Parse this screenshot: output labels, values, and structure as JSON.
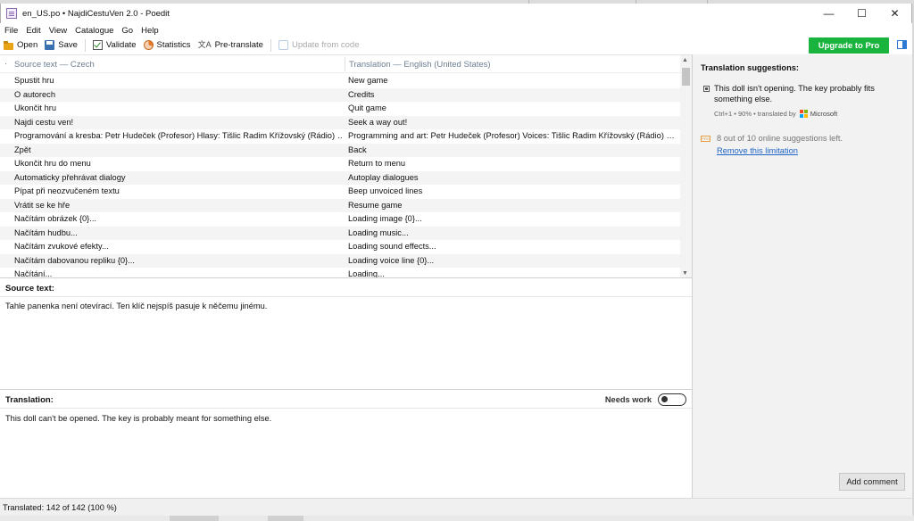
{
  "window": {
    "title": "en_US.po • NajdiCestuVen 2.0 - Poedit",
    "minimize": "—",
    "maximize": "☐",
    "close": "✕"
  },
  "menu": [
    "File",
    "Edit",
    "View",
    "Catalogue",
    "Go",
    "Help"
  ],
  "toolbar": {
    "open": "Open",
    "save": "Save",
    "validate": "Validate",
    "statistics": "Statistics",
    "pretranslate": "Pre-translate",
    "update_from_code": "Update from code",
    "upgrade": "Upgrade to Pro"
  },
  "list": {
    "source_header": "Source text — Czech",
    "translation_header": "Translation — English (United States)",
    "rows": [
      {
        "source": "Spustit hru",
        "translation": "New game"
      },
      {
        "source": "O autorech",
        "translation": "Credits"
      },
      {
        "source": "Ukončit hru",
        "translation": "Quit game"
      },
      {
        "source": "Najdi cestu ven!",
        "translation": "Seek a way out!"
      },
      {
        "source": "Programování a kresba:  Petr Hudeček (Profesor)  Hlasy:  Tišlic Radim Křížovský (Rádio)  …",
        "translation": "Programming and art:  Petr Hudeček (Profesor)  Voices:  Tišlic Radim Křížovský (Rádio)  …"
      },
      {
        "source": "Zpět",
        "translation": "Back"
      },
      {
        "source": "Ukončit hru do menu",
        "translation": "Return to menu"
      },
      {
        "source": "Automaticky přehrávat dialogy",
        "translation": "Autoplay dialogues"
      },
      {
        "source": "Pípat při neozvučeném textu",
        "translation": "Beep unvoiced lines"
      },
      {
        "source": "Vrátit se ke hře",
        "translation": "Resume game"
      },
      {
        "source": "Načítám obrázek {0}...",
        "translation": "Loading image {0}..."
      },
      {
        "source": "Načítám hudbu...",
        "translation": "Loading music..."
      },
      {
        "source": "Načítám zvukové efekty...",
        "translation": "Loading sound effects..."
      },
      {
        "source": "Načítám dabovanou repliku {0}...",
        "translation": "Loading voice line {0}..."
      },
      {
        "source": "Načítání...",
        "translation": "Loading..."
      }
    ]
  },
  "source_panel": {
    "label": "Source text:",
    "text": "Tahle panenka není otevírací. Ten klíč nejspíš pasuje k něčemu jinému."
  },
  "translation_panel": {
    "label": "Translation:",
    "needs_work": "Needs work",
    "text": "This doll can't be opened. The key is probably meant for something else."
  },
  "suggestions": {
    "title": "Translation suggestions:",
    "item_text": "This doll isn't opening. The key probably fits something else.",
    "item_meta": "Ctrl+1 • 90% • translated by",
    "provider": "Microsoft",
    "online_left": "8 out of 10 online suggestions left.",
    "remove_limit": "Remove this limitation",
    "add_comment": "Add comment"
  },
  "status": {
    "text": "Translated: 142 of 142 (100 %)"
  },
  "colors": {
    "upgrade_green": "#19b43d",
    "link_blue": "#1f64c7",
    "header_gray": "#6d7f91",
    "sidebar_bg": "#f2f2f2"
  }
}
